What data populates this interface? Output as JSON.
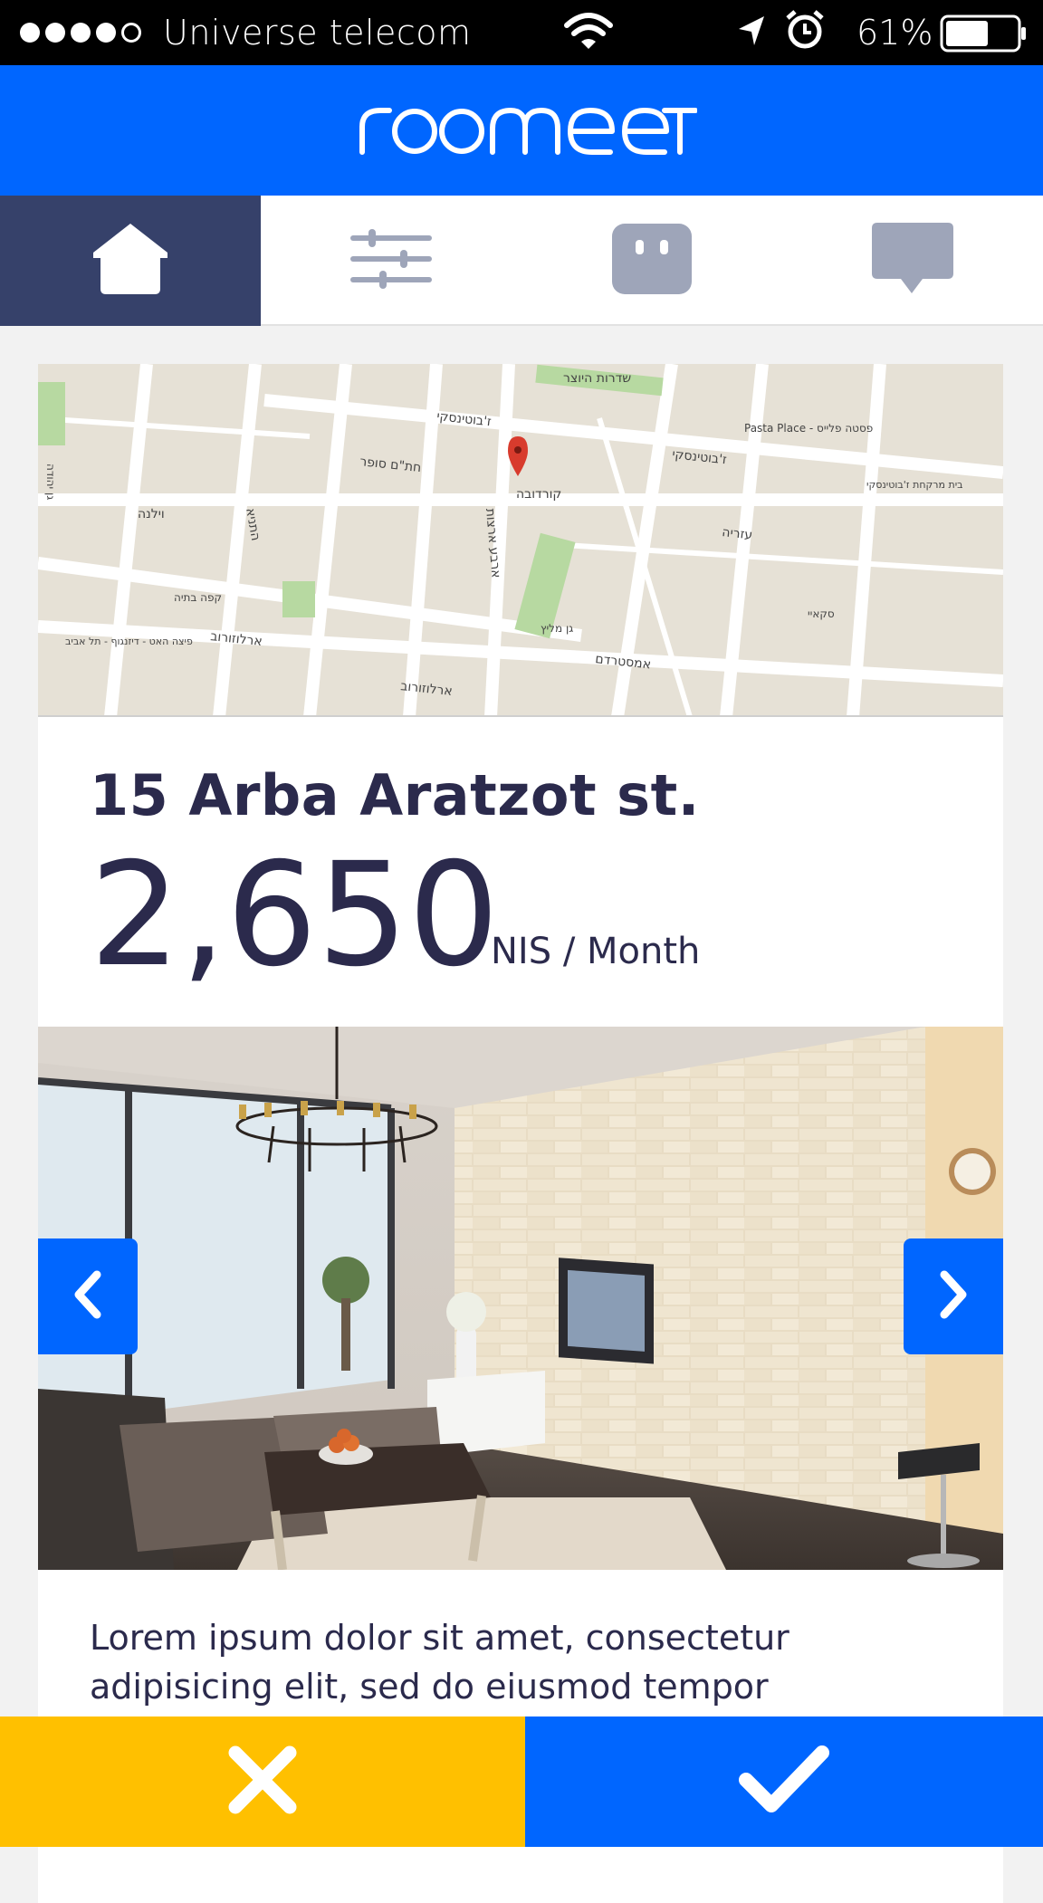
{
  "status_bar": {
    "signal_bars": 4,
    "signal_max": 5,
    "carrier": "Universe telecom",
    "battery_percent": "61%",
    "battery_level": 0.61,
    "icons": [
      "wifi-icon",
      "location-arrow-icon",
      "alarm-icon",
      "battery-icon"
    ]
  },
  "header": {
    "logo_text": "roomeet",
    "background": "#0066ff"
  },
  "tabs": [
    {
      "name": "home",
      "icon": "house-icon",
      "active": true
    },
    {
      "name": "filters",
      "icon": "sliders-icon",
      "active": false
    },
    {
      "name": "profile",
      "icon": "face-icon",
      "active": false
    },
    {
      "name": "messages",
      "icon": "chat-bubble-icon",
      "active": false
    }
  ],
  "listing": {
    "map_labels": {
      "street_1": "שדרות היוצר",
      "street_2": "ז'בוטינסקי",
      "street_3": "ז'בוטינסקי",
      "street_4": "חת\"ם סופר",
      "street_5": "קורדובה",
      "street_6": "ארלוזורוב",
      "street_7": "ארלוזורוב",
      "street_8": "אמסטרדם",
      "street_9": "עזריה",
      "street_10": "וילנה",
      "street_11": "התניא",
      "street_12": "ארבע ארצות",
      "poi_1": "Pasta Place - פסטה פלייס",
      "poi_2": "בית מרקחת ז'בוטינסקי",
      "poi_3": "קפה בתיה",
      "poi_4": "פיצה האט - דיזנגוף - תל אביב",
      "poi_5": "גן מליץ",
      "poi_6": "סקאיי",
      "poi_7": "גן יהודה"
    },
    "address": "15 Arba Aratzot st.",
    "price": "2,650",
    "price_unit": "NIS / Month",
    "description": "Lorem ipsum dolor sit amet, consectetur adipisicing elit,  sed do eiusmod tempor"
  },
  "gallery": {
    "prev_icon": "chevron-left-icon",
    "next_icon": "chevron-right-icon"
  },
  "actions": {
    "reject_icon": "close-icon",
    "accept_icon": "check-icon",
    "reject_color": "#ffc000",
    "accept_color": "#0066ff"
  },
  "colors": {
    "accent": "#0066ff",
    "active_tab": "#36416a",
    "inactive_icon": "#9ea5b9",
    "text_dark": "#2b2a4c"
  }
}
